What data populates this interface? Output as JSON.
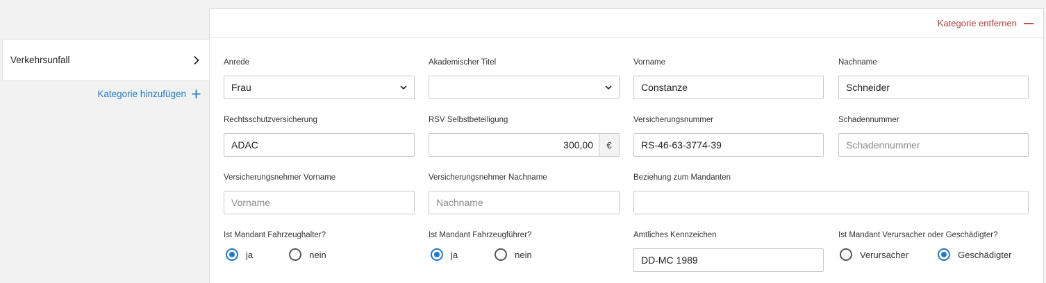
{
  "sidebar": {
    "category": "Verkehrsunfall",
    "add_category": "Kategorie hinzufügen"
  },
  "panel": {
    "remove_category": "Kategorie entfernen"
  },
  "form": {
    "anrede": {
      "label": "Anrede",
      "value": "Frau"
    },
    "titel": {
      "label": "Akademischer Titel",
      "value": ""
    },
    "vorname": {
      "label": "Vorname",
      "value": "Constanze"
    },
    "nachname": {
      "label": "Nachname",
      "value": "Schneider"
    },
    "rsv": {
      "label": "Rechtsschutzversicherung",
      "value": "ADAC"
    },
    "selbstbeteiligung": {
      "label": "RSV Selbstbeteiligung",
      "value": "300,00",
      "currency": "€"
    },
    "versicherungsnummer": {
      "label": "Versicherungsnummer",
      "value": "RS-46-63-3774-39"
    },
    "schadennummer": {
      "label": "Schadennummer",
      "value": "",
      "placeholder": "Schadennummer"
    },
    "vn_vorname": {
      "label": "Versicherungsnehmer Vorname",
      "value": "",
      "placeholder": "Vorname"
    },
    "vn_nachname": {
      "label": "Versicherungsnehmer Nachname",
      "value": "",
      "placeholder": "Nachname"
    },
    "beziehung": {
      "label": "Beziehung zum Mandanten",
      "value": ""
    },
    "fahrzeughalter": {
      "label": "Ist Mandant Fahrzeughalter?",
      "options": [
        "ja",
        "nein"
      ],
      "selected": "ja"
    },
    "fahrzeugfuehrer": {
      "label": "Ist Mandant Fahrzeugführer?",
      "options": [
        "ja",
        "nein"
      ],
      "selected": "ja"
    },
    "kennzeichen": {
      "label": "Amtliches Kennzeichen",
      "value": "DD-MC 1989"
    },
    "verursacher": {
      "label": "Ist Mandant Verursacher oder Geschädigter?",
      "options": [
        "Verursacher",
        "Geschädigter"
      ],
      "selected": "Geschädigter"
    }
  },
  "colors": {
    "accent": "#1f78c8",
    "danger": "#b23a3a"
  },
  "icons": {
    "chevron": "chevron-right-icon",
    "add": "plus-icon",
    "remove": "minus-icon",
    "dropdown": "chevron-down-icon"
  }
}
